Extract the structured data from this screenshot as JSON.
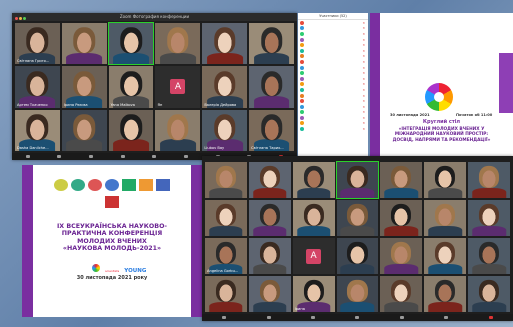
{
  "top_window": {
    "title": "Zoom Фотография конференции",
    "participant_names": [
      "Світлана Григо...",
      "",
      "",
      "",
      "",
      "",
      "Артем Ткаченко",
      "Ірина Рєєсва",
      "Yana Malkova",
      "Ян",
      "Валерія Дейрова",
      "",
      "Dasha Danilche...",
      "",
      "",
      "",
      "Liubov Bay",
      "Світлана Тарих..."
    ],
    "avatar_letter": "A"
  },
  "participants_panel": {
    "title": "Участники (52)",
    "rows": [
      "",
      "",
      "",
      "",
      "",
      "",
      "",
      "",
      "",
      "",
      "",
      "",
      "",
      "",
      "",
      "",
      "",
      "",
      "",
      ""
    ]
  },
  "right_slide": {
    "date": "30 листопада 2021",
    "time": "Початок об 11:00",
    "heading": "Круглий стіл",
    "body": "«ІНТЕГРАЦІЯ МОЛОДИХ ВЧЕНИХ У МІЖНАРОДНИЙ НАУКОВИЙ ПРОСТІР: ДОСВІД, НАПРЯМИ ТА РЕКОМЕНДАЦІЇ»"
  },
  "left_slide": {
    "line1": "IX ВСЕУКРАЇНСЬКА НАУКОВО-",
    "line2": "ПРАКТИЧНА КОНФЕРЕНЦІЯ",
    "line3": "МОЛОДИХ ВЧЕНИХ",
    "line4": "«НАУКОВА МОЛОДЬ-2021»",
    "logo_text": "YOUNG",
    "logo_small": "scientists",
    "date": "30 листопада 2021 року"
  },
  "bottom_window": {
    "names": [
      "",
      "",
      "",
      "",
      "",
      "",
      "",
      "",
      "",
      "",
      "",
      "",
      "",
      "",
      "Angelina  Gorbu...",
      "",
      "",
      "",
      "",
      "",
      "",
      "",
      "",
      "Ірина",
      "",
      "",
      "",
      ""
    ],
    "avatar_letter": "A"
  },
  "colors": {
    "purple": "#7a2ea0",
    "accent_green": "#2ad12a",
    "avatar": "#d44466"
  }
}
